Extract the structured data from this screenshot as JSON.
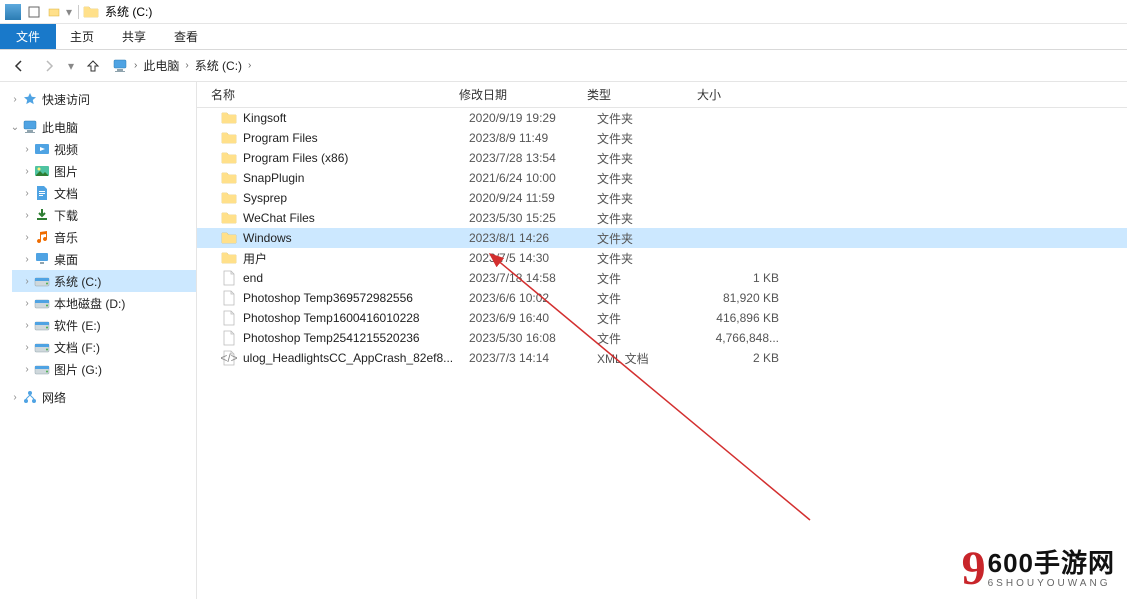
{
  "window": {
    "title": "系统 (C:)"
  },
  "ribbon": {
    "file": "文件",
    "tabs": [
      "主页",
      "共享",
      "查看"
    ]
  },
  "breadcrumb": {
    "pc": "此电脑",
    "drive": "系统 (C:)"
  },
  "quick_access": {
    "label": "快速访问"
  },
  "this_pc": {
    "label": "此电脑"
  },
  "tree_items": [
    {
      "label": "视频",
      "icon": "video"
    },
    {
      "label": "图片",
      "icon": "pictures"
    },
    {
      "label": "文档",
      "icon": "docs"
    },
    {
      "label": "下载",
      "icon": "downloads"
    },
    {
      "label": "音乐",
      "icon": "music"
    },
    {
      "label": "桌面",
      "icon": "desktop"
    },
    {
      "label": "系统 (C:)",
      "icon": "drive",
      "selected": true
    },
    {
      "label": "本地磁盘 (D:)",
      "icon": "drive"
    },
    {
      "label": "软件 (E:)",
      "icon": "drive"
    },
    {
      "label": "文档 (F:)",
      "icon": "drive"
    },
    {
      "label": "图片 (G:)",
      "icon": "drive"
    }
  ],
  "network": {
    "label": "网络"
  },
  "columns": {
    "name": "名称",
    "date": "修改日期",
    "type": "类型",
    "size": "大小"
  },
  "files": [
    {
      "name": "Kingsoft",
      "date": "2020/9/19 19:29",
      "type": "文件夹",
      "size": "",
      "icon": "folder"
    },
    {
      "name": "Program Files",
      "date": "2023/8/9 11:49",
      "type": "文件夹",
      "size": "",
      "icon": "folder"
    },
    {
      "name": "Program Files (x86)",
      "date": "2023/7/28 13:54",
      "type": "文件夹",
      "size": "",
      "icon": "folder"
    },
    {
      "name": "SnapPlugin",
      "date": "2021/6/24 10:00",
      "type": "文件夹",
      "size": "",
      "icon": "folder"
    },
    {
      "name": "Sysprep",
      "date": "2020/9/24 11:59",
      "type": "文件夹",
      "size": "",
      "icon": "folder"
    },
    {
      "name": "WeChat Files",
      "date": "2023/5/30 15:25",
      "type": "文件夹",
      "size": "",
      "icon": "folder"
    },
    {
      "name": "Windows",
      "date": "2023/8/1 14:26",
      "type": "文件夹",
      "size": "",
      "icon": "folder",
      "selected": true
    },
    {
      "name": "用户",
      "date": "2023/7/5 14:30",
      "type": "文件夹",
      "size": "",
      "icon": "folder"
    },
    {
      "name": "end",
      "date": "2023/7/18 14:58",
      "type": "文件",
      "size": "1 KB",
      "icon": "doc"
    },
    {
      "name": "Photoshop Temp369572982556",
      "date": "2023/6/6 10:02",
      "type": "文件",
      "size": "81,920 KB",
      "icon": "doc"
    },
    {
      "name": "Photoshop Temp1600416010228",
      "date": "2023/6/9 16:40",
      "type": "文件",
      "size": "416,896 KB",
      "icon": "doc"
    },
    {
      "name": "Photoshop Temp2541215520236",
      "date": "2023/5/30 16:08",
      "type": "文件",
      "size": "4,766,848...",
      "icon": "doc"
    },
    {
      "name": "ulog_HeadlightsCC_AppCrash_82ef8...",
      "date": "2023/7/3 14:14",
      "type": "XML 文档",
      "size": "2 KB",
      "icon": "xml"
    }
  ],
  "watermark": {
    "logo": "9",
    "cn": "600手游网",
    "en": "6SHOUYOUWANG"
  }
}
